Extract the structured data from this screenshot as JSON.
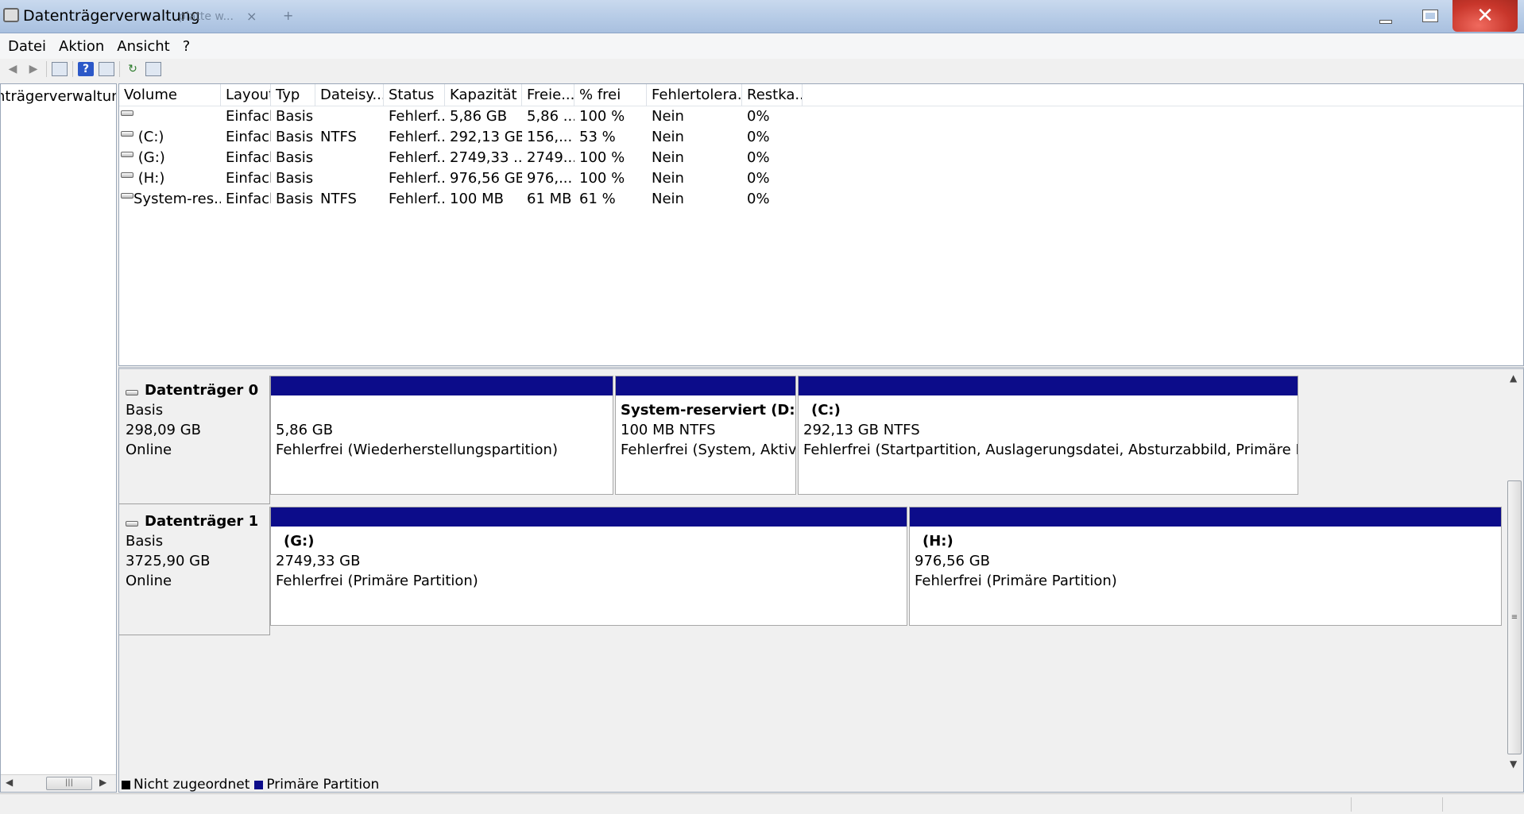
{
  "window": {
    "title": "Datenträgerverwaltung",
    "ghost_tab": "platte w...",
    "ghost_close": "×",
    "ghost_add": "+",
    "icon": "disk-management-icon",
    "buttons": {
      "minimize": "",
      "maximize": "",
      "close": "✕"
    }
  },
  "menu": [
    "Datei",
    "Aktion",
    "Ansicht",
    "?"
  ],
  "toolbar": {
    "icons": [
      "back-arrow-icon",
      "forward-arrow-icon",
      "show-hide-console-tree-icon",
      "help-icon",
      "properties-icon",
      "refresh-icon",
      "export-list-icon"
    ],
    "help_glyph": "?"
  },
  "tree": {
    "root_label": "Datenträgerverwaltung",
    "visible_label": "nträgerverwaltung"
  },
  "volume_table": {
    "columns": [
      "Volume",
      "Layout",
      "Typ",
      "Dateisy...",
      "Status",
      "Kapazität",
      "Freie...",
      "% frei",
      "Fehlertolera...",
      "Restka..."
    ],
    "rows": [
      [
        "",
        "Einfach",
        "Basis",
        "",
        "Fehlerf...",
        "5,86 GB",
        "5,86 ...",
        "100 %",
        "Nein",
        "0%"
      ],
      [
        "(C:)",
        "Einfach",
        "Basis",
        "NTFS",
        "Fehlerf...",
        "292,13 GB",
        "156,...",
        "53 %",
        "Nein",
        "0%"
      ],
      [
        "(G:)",
        "Einfach",
        "Basis",
        "",
        "Fehlerf...",
        "2749,33 ...",
        "2749...",
        "100 %",
        "Nein",
        "0%"
      ],
      [
        "(H:)",
        "Einfach",
        "Basis",
        "",
        "Fehlerf...",
        "976,56 GB",
        "976,...",
        "100 %",
        "Nein",
        "0%"
      ],
      [
        "System-res...",
        "Einfach",
        "Basis",
        "NTFS",
        "Fehlerf...",
        "100 MB",
        "61 MB",
        "61 %",
        "Nein",
        "0%"
      ]
    ]
  },
  "disks": [
    {
      "name": "Datenträger 0",
      "type": "Basis",
      "size": "298,09 GB",
      "status": "Online",
      "partitions": [
        {
          "label": "",
          "size": "5,86 GB",
          "status": "Fehlerfrei (Wiederherstellungspartition)"
        },
        {
          "label": "System-reserviert  (D:)",
          "size": "100 MB NTFS",
          "status": "Fehlerfrei (System, Aktiv, Pr"
        },
        {
          "label": "(C:)",
          "size": "292,13 GB NTFS",
          "status": "Fehlerfrei (Startpartition, Auslagerungsdatei, Absturzabbild, Primäre Partition)"
        }
      ]
    },
    {
      "name": "Datenträger 1",
      "type": "Basis",
      "size": "3725,90 GB",
      "status": "Online",
      "partitions": [
        {
          "label": "(G:)",
          "size": "2749,33 GB",
          "status": "Fehlerfrei (Primäre Partition)"
        },
        {
          "label": "(H:)",
          "size": "976,56 GB",
          "status": "Fehlerfrei (Primäre Partition)"
        }
      ]
    }
  ],
  "legend": [
    {
      "label": "Nicht zugeordnet",
      "color": "#000000"
    },
    {
      "label": "Primäre Partition",
      "color": "#0c0c8a"
    }
  ],
  "colors": {
    "primary_partition_bar": "#0c0c8a",
    "title_bar": "#b6cbe6",
    "close_button": "#c8362b"
  },
  "scroll_arrows": {
    "left": "◀",
    "right": "▶",
    "up": "▲",
    "down": "▼",
    "grip": "|||",
    "grip_vertical": "≡"
  }
}
